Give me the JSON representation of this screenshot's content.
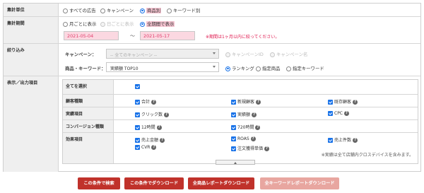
{
  "aggregation_unit": {
    "label": "集計単位",
    "options": [
      "すべての広告",
      "キャンペーン",
      "商品別",
      "キーワード別"
    ],
    "selected": 2
  },
  "aggregation_period": {
    "label": "集計期間",
    "options": [
      "月ごとに表示",
      "日ごとに表示",
      "全期間で表示"
    ],
    "selected": 2,
    "start_date": "2021-05-04",
    "separator": "〜",
    "end_date": "2021-05-17",
    "note": "※期間は1ヶ月以内に絞ってください。"
  },
  "filter": {
    "label": "絞り込み",
    "campaign_label": "キャンペーン：",
    "campaign_select": "-- 全てのキャンペーン --",
    "campaign_options": [
      "キャンペーンID",
      "キャンペーン名"
    ],
    "product_label": "商品・キーワード：",
    "product_select": "実績額 TOP10",
    "product_options": [
      "ランキング",
      "指定商品",
      "指定キーワード"
    ],
    "product_selected": 0
  },
  "display": {
    "label": "表示／出力項目",
    "select_all": "全てを選択",
    "groups": [
      {
        "label": "顧客種類",
        "items": [
          "合計",
          "新規顧客",
          "既存顧客"
        ]
      },
      {
        "label": "実績項目",
        "items": [
          "クリック数",
          "実績額",
          "CPC"
        ]
      },
      {
        "label": "コンバージョン種類",
        "items": [
          "12時間",
          "720時間"
        ]
      },
      {
        "label": "効果項目",
        "items": [
          "売上金額",
          "ROAS",
          "売上件数",
          "CVR",
          "注文獲得単価"
        ]
      }
    ],
    "note": "※実績は全て店舗内クロスデバイスを含みます。"
  },
  "buttons": [
    "この条件で検索",
    "この条件でダウンロード",
    "全商品レポートダウンロード",
    "全キーワードレポートダウンロード"
  ],
  "colors": {
    "accent": "#1a73e8",
    "button": "#c0322b",
    "button_disabled": "#e8a6a0",
    "highlight": "#f7c5d2",
    "note": "#e0194f"
  }
}
